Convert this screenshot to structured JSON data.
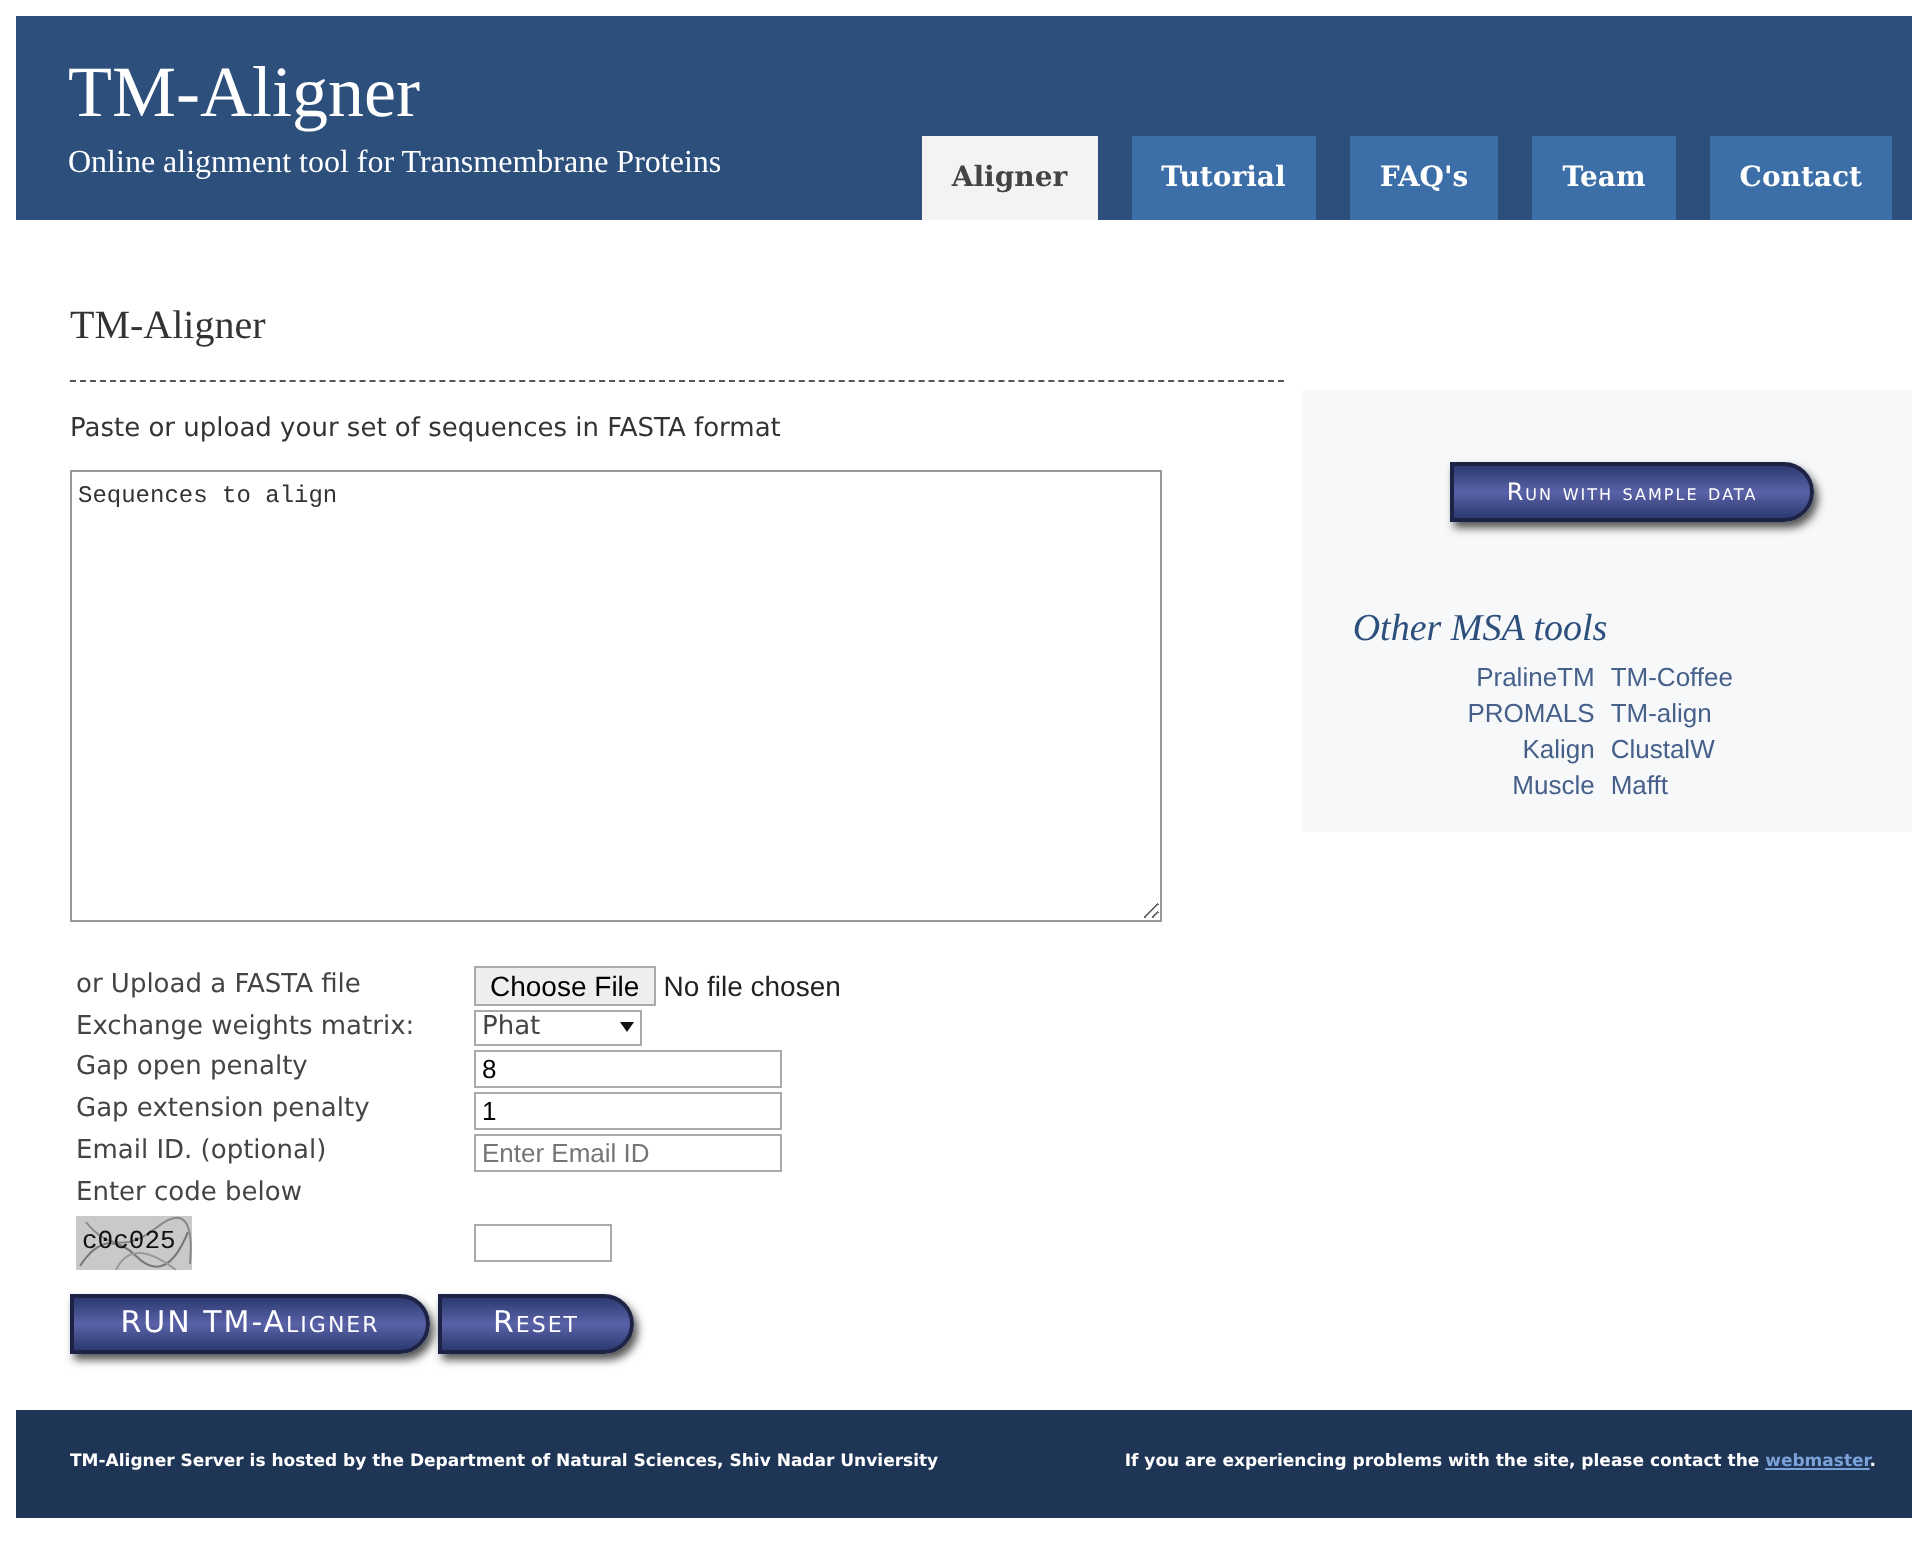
{
  "header": {
    "title": "TM-Aligner",
    "subtitle": "Online alignment tool for Transmembrane Proteins"
  },
  "tabs": [
    {
      "label": "Aligner",
      "selected": true
    },
    {
      "label": "Tutorial",
      "selected": false
    },
    {
      "label": "FAQ's",
      "selected": false
    },
    {
      "label": "Team",
      "selected": false
    },
    {
      "label": "Contact",
      "selected": false
    }
  ],
  "page_title": "TM-Aligner",
  "instruction": "Paste or upload your set of sequences in FASTA format",
  "sequences": {
    "placeholder": "Sequences to align"
  },
  "form": [
    {
      "kind": "file",
      "label": "or Upload a FASTA file",
      "button": "Choose File",
      "status": "No file chosen"
    },
    {
      "kind": "select",
      "label": "Exchange weights matrix:",
      "value": "Phat"
    },
    {
      "kind": "text",
      "label": "Gap open penalty",
      "value": "8"
    },
    {
      "kind": "text",
      "label": "Gap extension penalty",
      "value": "1"
    },
    {
      "kind": "text",
      "label": "Email ID. (optional)",
      "placeholder": "Enter Email ID"
    }
  ],
  "captcha": {
    "label": "Enter code below",
    "code": "c0c025"
  },
  "buttons": [
    "RUN TM-Aligner",
    "Reset"
  ],
  "sidebar": {
    "sample_button": "Run with sample data",
    "heading": "Other MSA tools",
    "tools": [
      [
        "PralineTM",
        "TM-Coffee"
      ],
      [
        "PROMALS",
        "TM-align"
      ],
      [
        "Kalign",
        "ClustalW"
      ],
      [
        "Muscle",
        "Mafft"
      ]
    ]
  },
  "footer": {
    "left": "TM-Aligner Server is hosted by the Department of Natural Sciences, Shiv Nadar Unviersity",
    "right": "If you are experiencing problems with the site, please contact the ",
    "link": "webmaster",
    "after": "."
  }
}
